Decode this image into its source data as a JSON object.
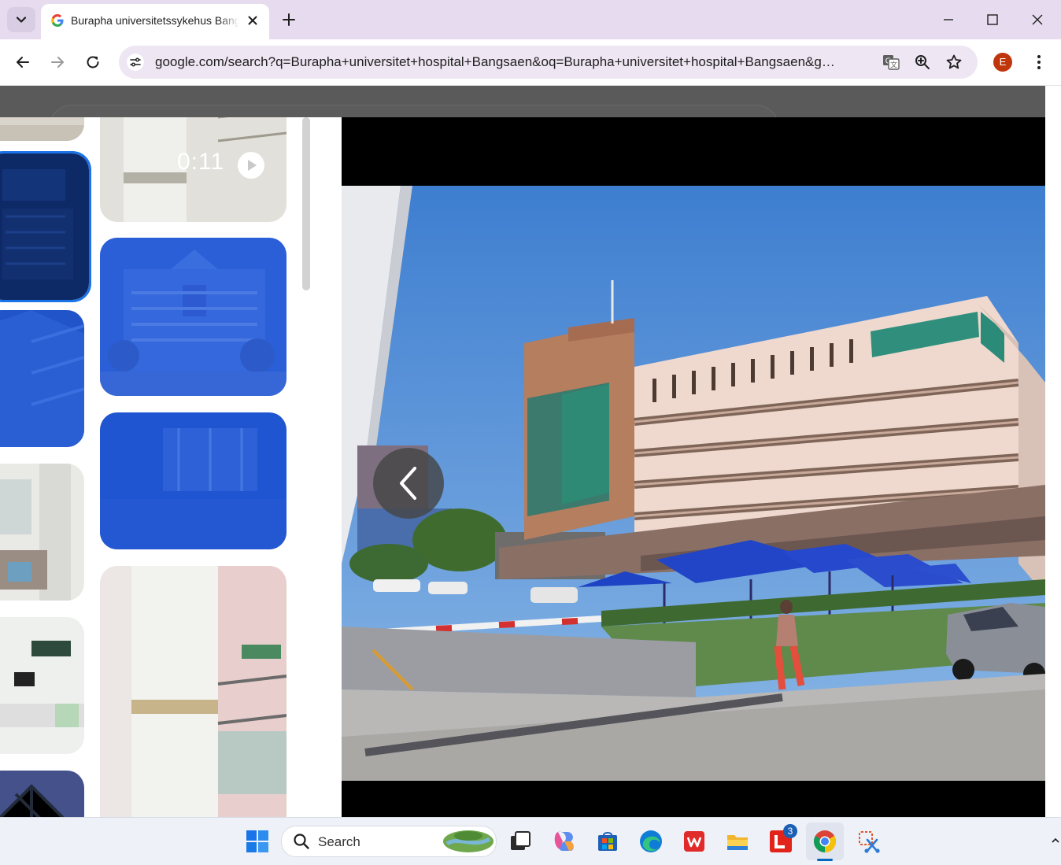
{
  "browser": {
    "tab": {
      "title": "Burapha universitetssykehus Bangsaen"
    },
    "url": "google.com/search?q=Burapha+universitet+hospital+Bangsaen&oq=Burapha+universitet+hospital+Bangsaen&gs_...",
    "profile_initial": "E"
  },
  "colors": {
    "tabstrip": "#e7dcef",
    "omnibox": "#eee6f3",
    "selection": "#1a73e8",
    "blue_overlay": "#1d4fd6",
    "avatar": "#c0360c"
  },
  "gallery": {
    "video_duration": "0:11"
  },
  "taskbar": {
    "search_label": "Search",
    "notification_count": "3",
    "icons": [
      "windows-start-icon",
      "search-icon",
      "task-view-icon",
      "copilot-icon",
      "microsoft-store-icon",
      "edge-icon",
      "wps-office-icon",
      "file-explorer-icon",
      "lenovo-vantage-icon",
      "chrome-icon",
      "snipping-tool-icon"
    ]
  }
}
